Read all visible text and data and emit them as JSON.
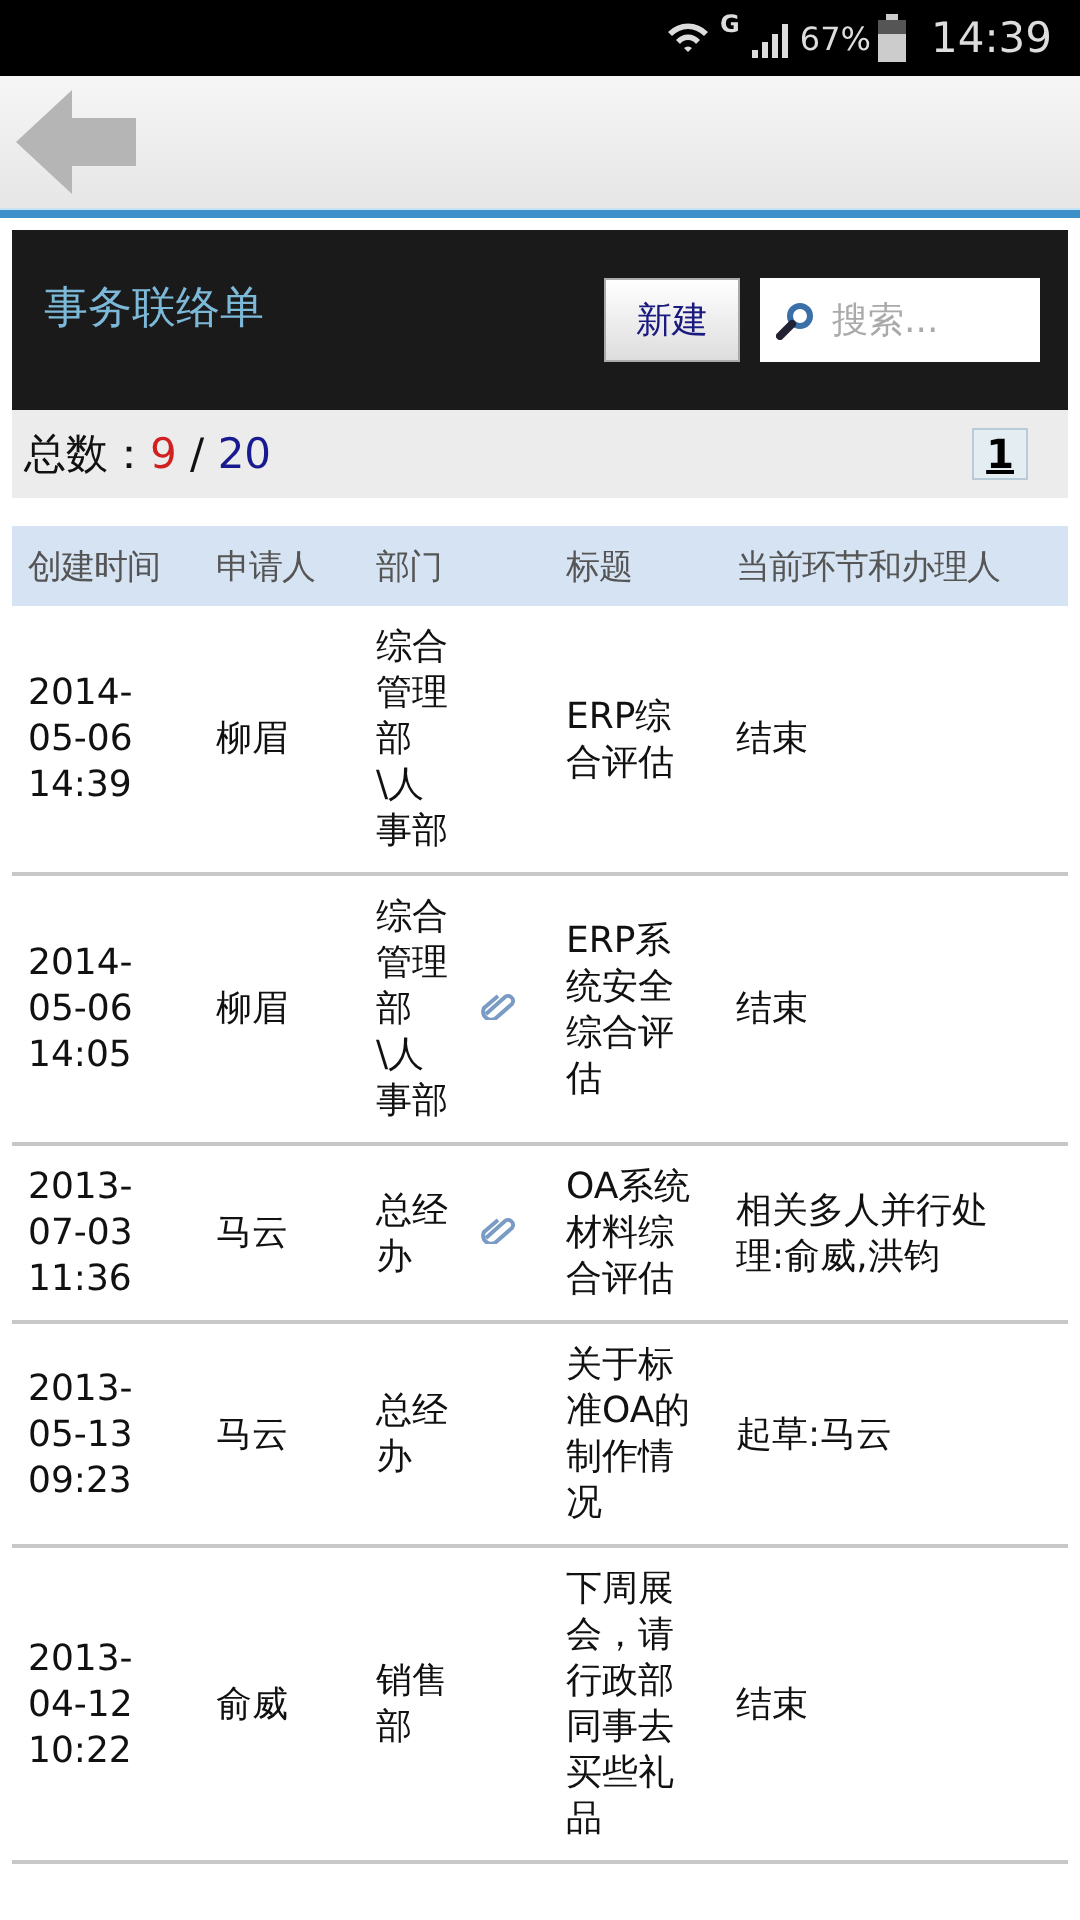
{
  "status_bar": {
    "network": "G",
    "battery": "67%",
    "time": "14:39"
  },
  "header": {
    "title": "事务联络单",
    "new_button": "新建",
    "search": {
      "placeholder": "搜索..."
    }
  },
  "summary": {
    "label": "总数：",
    "current": "9",
    "separator": "/",
    "total": "20",
    "pages": [
      {
        "label": "1",
        "selected": true
      }
    ]
  },
  "table": {
    "columns": [
      "创建时间",
      "申请人",
      "部门",
      "",
      "标题",
      "当前环节和办理人"
    ],
    "rows": [
      {
        "created": "2014-05-06 14:39",
        "applicant": "柳眉",
        "department": "综合管理部\\人事部",
        "attachment": false,
        "title": "ERP综合评估",
        "status": "结束"
      },
      {
        "created": "2014-05-06 14:05",
        "applicant": "柳眉",
        "department": "综合管理部\\人事部",
        "attachment": true,
        "title": "ERP系统安全综合评估",
        "status": "结束"
      },
      {
        "created": "2013-07-03 11:36",
        "applicant": "马云",
        "department": "总经办",
        "attachment": true,
        "title": "OA系统材料综合评估",
        "status": "相关多人并行处理:俞威,洪钧"
      },
      {
        "created": "2013-05-13 09:23",
        "applicant": "马云",
        "department": "总经办",
        "attachment": false,
        "title": "关于标准OA的制作情况",
        "status": "起草:马云"
      },
      {
        "created": "2013-04-12 10:22",
        "applicant": "俞威",
        "department": "销售部",
        "attachment": false,
        "title": "下周展会，请行政部同事去买些礼品",
        "status": "结束"
      }
    ]
  }
}
